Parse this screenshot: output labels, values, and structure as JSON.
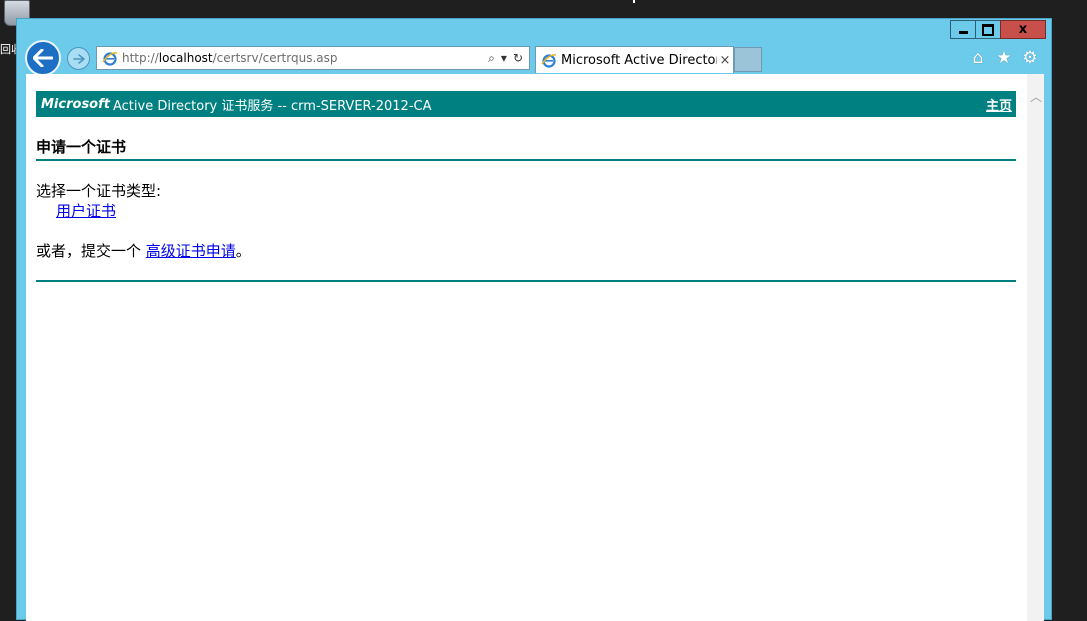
{
  "desktop": {
    "icon_label": "回收站"
  },
  "window": {
    "controls": {
      "minimize": "",
      "maximize": "",
      "close": "x"
    }
  },
  "navbar": {
    "address_prefix": "http://",
    "address_host": "localhost",
    "address_path": "/certsrv/certrqus.asp",
    "search_icon": "⌕",
    "dropdown_icon": "▾",
    "refresh_icon": "↻"
  },
  "tab": {
    "title": "Microsoft Active Director...",
    "close": "×"
  },
  "toolbar": {
    "home_icon": "⌂",
    "favorites_icon": "★",
    "settings_icon": "⚙"
  },
  "page": {
    "banner_brand": "Microsoft",
    "banner_service": "Active Directory 证书服务  --  crm-SERVER-2012-CA",
    "home_link": "主页",
    "title": "申请一个证书",
    "choose_type": "选择一个证书类型:",
    "user_cert_link": "用户证书",
    "or_submit": "或者，提交一个 ",
    "advanced_link": "高级证书申请",
    "period": "。"
  },
  "colors": {
    "accent": "#008080",
    "frame": "#6ccbeb",
    "close_button": "#c7504a",
    "link": "#0000ee"
  }
}
